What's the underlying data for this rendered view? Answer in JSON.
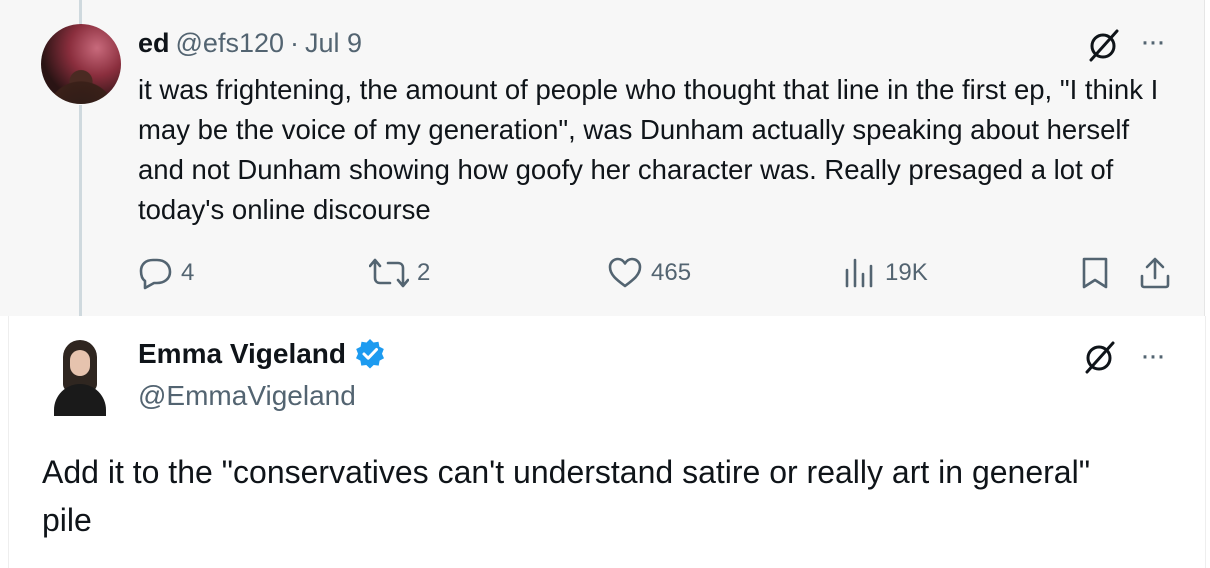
{
  "parent_tweet": {
    "author_name": "ed",
    "handle": "@efs120",
    "separator": "·",
    "date": "Jul 9",
    "text": "it was frightening, the amount of people who thought that line in the first ep, \"I think I may be the voice of my generation\", was Dunham actually speaking about herself and not Dunham showing how goofy her character was. Really presaged a lot of today's online discourse",
    "replies": "4",
    "reposts": "2",
    "likes": "465",
    "views": "19K",
    "more_label": "···"
  },
  "reply_tweet": {
    "author_name": "Emma Vigeland",
    "handle": "@EmmaVigeland",
    "verified": true,
    "text": "Add it to the \"conservatives can't understand satire or really art in general\" pile",
    "more_label": "···"
  },
  "icons": {
    "reply": "reply-bubble-icon",
    "repost": "repost-icon",
    "like": "heart-icon",
    "views": "views-bars-icon",
    "bookmark": "bookmark-icon",
    "share": "share-upload-icon",
    "grok": "grok-slash-icon",
    "verified": "verified-badge-icon"
  },
  "colors": {
    "text": "#0f1419",
    "secondary": "#536471",
    "verified": "#1d9bf0",
    "parent_background": "#f7f7f7"
  }
}
